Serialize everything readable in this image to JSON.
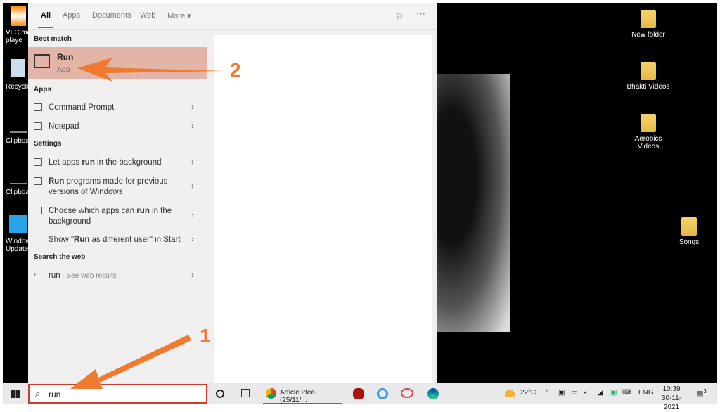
{
  "desktop": {
    "left_icons": [
      "VLC me\nplaye",
      "Recycle",
      "Clipboa",
      "Clipboa",
      "Window\nUpdate"
    ],
    "right_icons": [
      "New folder",
      "Bhakti Videos",
      "Aerobics Videos",
      "Songs"
    ]
  },
  "start_menu": {
    "tabs": [
      "All",
      "Apps",
      "Documents",
      "Web",
      "More"
    ],
    "active_tab": "All",
    "best_match_header": "Best match",
    "best_match": {
      "title": "Run",
      "subtitle": "App"
    },
    "apps_header": "Apps",
    "apps": [
      "Command Prompt",
      "Notepad"
    ],
    "settings_header": "Settings",
    "settings": [
      {
        "pre": "Let apps ",
        "bold": "run",
        "post": " in the background"
      },
      {
        "pre": "",
        "bold": "Run",
        "post": " programs made for previous versions of Windows"
      },
      {
        "pre": "Choose which apps can ",
        "bold": "run",
        "post": " in the background"
      },
      {
        "pre": "Show \"",
        "bold": "Run",
        "post": " as different user\" in Start"
      }
    ],
    "web_header": "Search the web",
    "web_item": {
      "query": "run",
      "suffix": " - See web results"
    }
  },
  "taskbar": {
    "search_value": "run",
    "chrome_tab": "Article Idea (25/11/...",
    "weather": "22°C",
    "language": "ENG",
    "time": "10:39",
    "date": "30-11-2021",
    "notifications": "3"
  },
  "annotations": {
    "label1": "1",
    "label2": "2",
    "color": "#f07a30"
  }
}
